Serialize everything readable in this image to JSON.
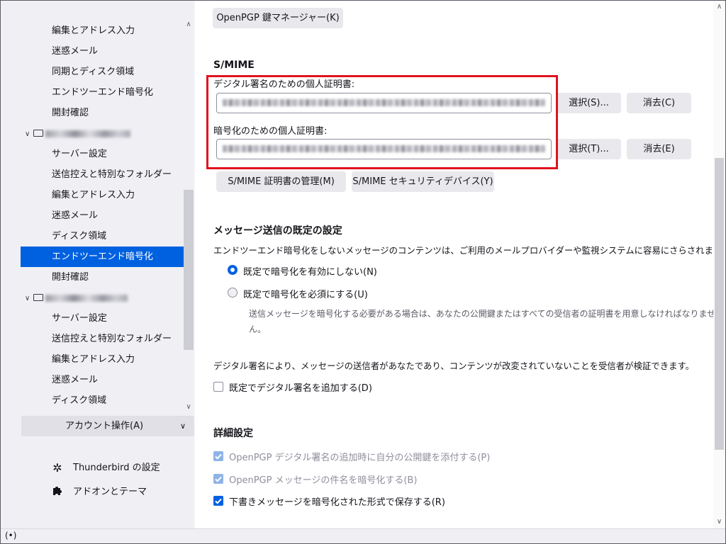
{
  "sidebar": {
    "items": [
      {
        "label": "編集とアドレス入力",
        "type": "item"
      },
      {
        "label": "迷惑メール",
        "type": "item"
      },
      {
        "label": "同期とディスク領域",
        "type": "item"
      },
      {
        "label": "エンドツーエンド暗号化",
        "type": "item"
      },
      {
        "label": "開封確認",
        "type": "item"
      },
      {
        "label": "",
        "type": "account"
      },
      {
        "label": "サーバー設定",
        "type": "item"
      },
      {
        "label": "送信控えと特別なフォルダー",
        "type": "item"
      },
      {
        "label": "編集とアドレス入力",
        "type": "item"
      },
      {
        "label": "迷惑メール",
        "type": "item"
      },
      {
        "label": "ディスク領域",
        "type": "item"
      },
      {
        "label": "エンドツーエンド暗号化",
        "type": "item",
        "selected": true
      },
      {
        "label": "開封確認",
        "type": "item"
      },
      {
        "label": "",
        "type": "account"
      },
      {
        "label": "サーバー設定",
        "type": "item"
      },
      {
        "label": "送信控えと特別なフォルダー",
        "type": "item"
      },
      {
        "label": "編集とアドレス入力",
        "type": "item"
      },
      {
        "label": "迷惑メール",
        "type": "item"
      },
      {
        "label": "ディスク領域",
        "type": "item"
      }
    ],
    "account_actions_label": "アカウント操作(A)",
    "settings_label": "Thunderbird の設定",
    "addons_label": "アドオンとテーマ",
    "settings_icon": "gear-icon",
    "addons_icon": "puzzle-icon"
  },
  "main": {
    "openpgp_manager_button": "OpenPGP 鍵マネージャー(K)",
    "smime_heading": "S/MIME",
    "signing_cert_label": "デジタル署名のための個人証明書:",
    "encryption_cert_label": "暗号化のための個人証明書:",
    "select_signing_button": "選択(S)...",
    "clear_signing_button": "消去(C)",
    "select_encryption_button": "選択(T)...",
    "clear_encryption_button": "消去(E)",
    "manage_certs_button": "S/MIME 証明書の管理(M)",
    "security_devices_button": "S/MIME セキュリティデバイス(Y)",
    "send_defaults_heading": "メッセージ送信の既定の設定",
    "send_defaults_description": "エンドツーエンド暗号化をしないメッセージのコンテンツは、ご利用のメールプロバイダーや監視システムに容易にさらされます。",
    "radio_no_encrypt": "既定で暗号化を有効にしない(N)",
    "radio_require_encrypt": "既定で暗号化を必須にする(U)",
    "require_encrypt_note_line1": "送信メッセージを暗号化する必要がある場合は、あなたの公開鍵またはすべての受信者の証明書を用意しなければなりませ",
    "require_encrypt_note_line2": "ん。",
    "signature_description": "デジタル署名により、メッセージの送信者があなたであり、コンテンツが改変されていないことを受信者が検証できます。",
    "add_signature_checkbox": "既定でデジタル署名を追加する(D)",
    "advanced_heading": "詳細設定",
    "attach_pubkey_checkbox": "OpenPGP デジタル署名の追加時に自分の公開鍵を添付する(P)",
    "encrypt_subject_checkbox": "OpenPGP メッセージの件名を暗号化する(B)",
    "save_drafts_encrypted_checkbox": "下書きメッセージを暗号化された形式で保存する(R)"
  },
  "state": {
    "radio_selected": "no_encrypt",
    "add_signature_checked": false,
    "attach_pubkey_checked": true,
    "attach_pubkey_disabled": true,
    "encrypt_subject_checked": true,
    "encrypt_subject_disabled": true,
    "save_drafts_encrypted_checked": true
  },
  "statusbar": {
    "icon": "broadcast-icon",
    "icon_glyph": "(•)"
  },
  "colors": {
    "accent": "#0061e0",
    "highlight_border": "#e0121e"
  }
}
